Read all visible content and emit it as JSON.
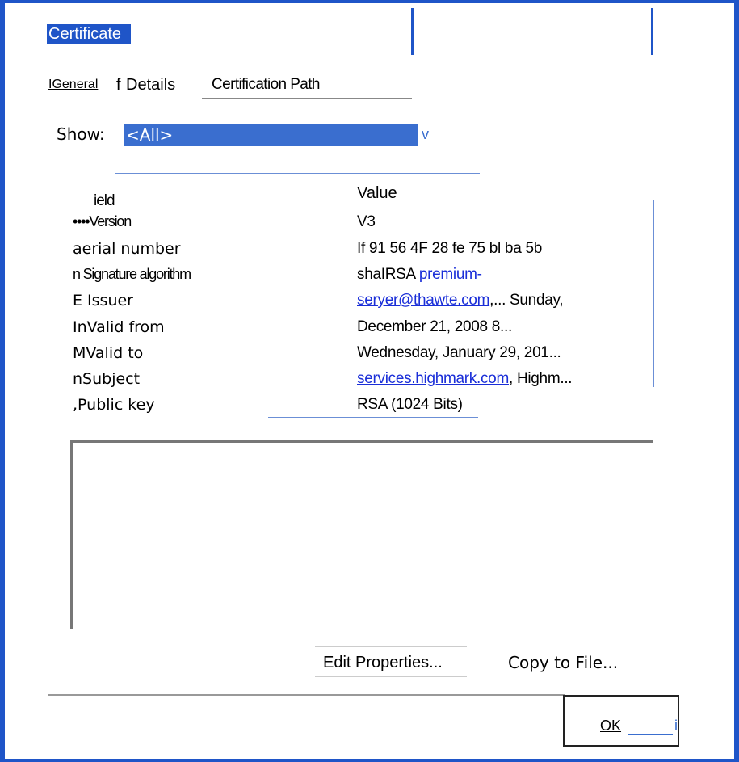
{
  "window": {
    "title": "Certificate"
  },
  "tabs": {
    "general": "IGeneral",
    "sep": "f",
    "details": "Details",
    "path": "Certification Path"
  },
  "show": {
    "label": "Show:",
    "value": "<All>",
    "arrow": "v"
  },
  "columns": {
    "field": "ield",
    "value": "Value"
  },
  "rows": [
    {
      "field": "••••Version",
      "value": "V3"
    },
    {
      "field": "aerial number",
      "value": "If 91 56 4F 28 fe 75 bl ba 5b"
    },
    {
      "field": "n Signature algorithm",
      "value_text": "shaIRSA ",
      "value_link": "premium-"
    },
    {
      "field": "E Issuer",
      "value_link": "seryer@thawte.com",
      "value_text": ",... Sunday,"
    },
    {
      "field": "InValid from",
      "value": "December 21, 2008 8..."
    },
    {
      "field": "MValid to",
      "value": "Wednesday, January 29, 201..."
    },
    {
      "field": "nSubject",
      "value_link": "services.highmark.com",
      "value_text": ", Highm..."
    },
    {
      "field": ",Public key",
      "value": "RSA (1024 Bits)"
    }
  ],
  "buttons": {
    "edit": "Edit Properties...",
    "copy": "Copy to File...",
    "ok": "OK",
    "ok_mark": "i"
  },
  "colors": {
    "accent": "#1f55c8",
    "select": "#3a6ecf",
    "link": "#1a2ed8"
  }
}
